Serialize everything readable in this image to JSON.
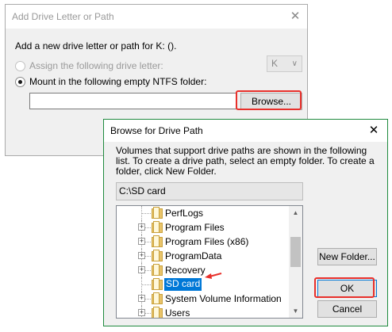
{
  "add_dialog": {
    "title": "Add Drive Letter or Path",
    "close_glyph": "✕",
    "prompt": "Add a new drive letter or path for K: ().",
    "option_assign": "Assign the following drive letter:",
    "drive_letter": "K",
    "option_mount": "Mount in the following empty NTFS folder:",
    "folder_value": "",
    "browse_label": "Browse..."
  },
  "browse_dialog": {
    "title": "Browse for Drive Path",
    "close_glyph": "✕",
    "description": "Volumes that support drive paths are shown in the following list. To create a drive path, select an empty folder. To create a folder, click New Folder.",
    "path_value": "C:\\SD card",
    "tree_items": [
      {
        "label": "PerfLogs",
        "expandable": false,
        "selected": false
      },
      {
        "label": "Program Files",
        "expandable": true,
        "selected": false
      },
      {
        "label": "Program Files (x86)",
        "expandable": true,
        "selected": false
      },
      {
        "label": "ProgramData",
        "expandable": true,
        "selected": false
      },
      {
        "label": "Recovery",
        "expandable": true,
        "selected": false
      },
      {
        "label": "SD card",
        "expandable": false,
        "selected": true
      },
      {
        "label": "System Volume Information",
        "expandable": true,
        "selected": false
      },
      {
        "label": "Users",
        "expandable": true,
        "selected": false
      }
    ],
    "new_folder_label": "New Folder...",
    "ok_label": "OK",
    "cancel_label": "Cancel"
  },
  "colors": {
    "highlight": "#e8302b",
    "selection": "#0078d7",
    "dialog_border": "#1f8a3e"
  }
}
